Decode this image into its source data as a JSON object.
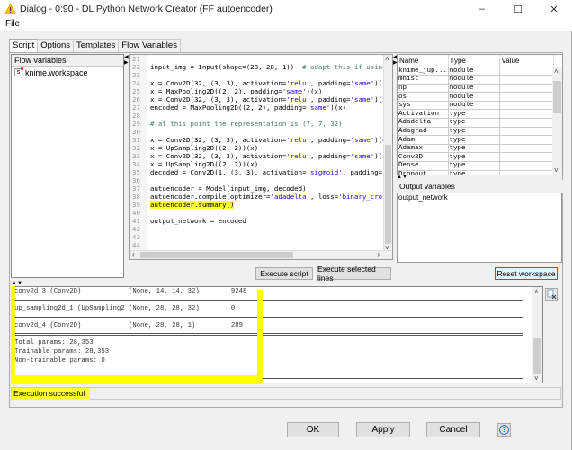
{
  "window": {
    "title": "Dialog - 0:90 - DL Python Network Creator (FF autoencoder)",
    "controls": {
      "minimize": "–",
      "maximize": "☐",
      "close": "✕"
    }
  },
  "menu": {
    "file": "File"
  },
  "tabs": [
    {
      "label": "Script",
      "active": true
    },
    {
      "label": "Options",
      "active": false
    },
    {
      "label": "Templates",
      "active": false
    },
    {
      "label": "Flow Variables",
      "active": false
    }
  ],
  "flow_variables": {
    "header": "Flow variables",
    "items": [
      {
        "icon": "s",
        "label": "knime.workspace"
      }
    ]
  },
  "editor": {
    "lines": [
      {
        "n": "21",
        "parts": []
      },
      {
        "n": "22",
        "parts": [
          {
            "t": "input_img = Input(shape=(28, 28, 1))  "
          },
          {
            "t": "# adapt this if using `c",
            "c": "cmt"
          }
        ]
      },
      {
        "n": "23",
        "parts": []
      },
      {
        "n": "24",
        "parts": [
          {
            "t": "x = Conv2D(32, (3, 3), activation="
          },
          {
            "t": "'relu'",
            "c": "str"
          },
          {
            "t": ", padding="
          },
          {
            "t": "'same'",
            "c": "str"
          },
          {
            "t": ")(inpu"
          }
        ]
      },
      {
        "n": "25",
        "parts": [
          {
            "t": "x = MaxPooling2D((2, 2), padding="
          },
          {
            "t": "'same'",
            "c": "str"
          },
          {
            "t": ")(x)"
          }
        ]
      },
      {
        "n": "26",
        "parts": [
          {
            "t": "x = Conv2D(32, (3, 3), activation="
          },
          {
            "t": "'relu'",
            "c": "str"
          },
          {
            "t": ", padding="
          },
          {
            "t": "'same'",
            "c": "str"
          },
          {
            "t": ")(x)"
          }
        ]
      },
      {
        "n": "27",
        "parts": [
          {
            "t": "encoded = MaxPooling2D((2, 2), padding="
          },
          {
            "t": "'same'",
            "c": "str"
          },
          {
            "t": ")(x)"
          }
        ]
      },
      {
        "n": "28",
        "parts": []
      },
      {
        "n": "29",
        "parts": [
          {
            "t": "# at this point the representation is (7, 7, 32)",
            "c": "cmt"
          }
        ]
      },
      {
        "n": "30",
        "parts": []
      },
      {
        "n": "31",
        "parts": [
          {
            "t": "x = Conv2D(32, (3, 3), activation="
          },
          {
            "t": "'relu'",
            "c": "str"
          },
          {
            "t": ", padding="
          },
          {
            "t": "'same'",
            "c": "str"
          },
          {
            "t": ")(enco"
          }
        ]
      },
      {
        "n": "32",
        "parts": [
          {
            "t": "x = UpSampling2D((2, 2))(x)"
          }
        ]
      },
      {
        "n": "33",
        "parts": [
          {
            "t": "x = Conv2D(32, (3, 3), activation="
          },
          {
            "t": "'relu'",
            "c": "str"
          },
          {
            "t": ", padding="
          },
          {
            "t": "'same'",
            "c": "str"
          },
          {
            "t": ")(x)"
          }
        ]
      },
      {
        "n": "34",
        "parts": [
          {
            "t": "x = UpSampling2D((2, 2))(x)"
          }
        ]
      },
      {
        "n": "35",
        "parts": [
          {
            "t": "decoded = Conv2D(1, (3, 3), activation="
          },
          {
            "t": "'sigmoid'",
            "c": "str"
          },
          {
            "t": ", padding="
          },
          {
            "t": "'sam",
            "c": "str"
          }
        ]
      },
      {
        "n": "36",
        "parts": []
      },
      {
        "n": "37",
        "parts": [
          {
            "t": "autoencoder = Model(input_img, decoded)"
          }
        ]
      },
      {
        "n": "38",
        "parts": [
          {
            "t": "autoencoder.compile(optimizer="
          },
          {
            "t": "'adadelta'",
            "c": "str"
          },
          {
            "t": ", loss="
          },
          {
            "t": "'binary_crossen",
            "c": "str"
          }
        ]
      },
      {
        "n": "39",
        "parts": [
          {
            "t": "autoencoder.summary()",
            "c": "hl"
          }
        ]
      },
      {
        "n": "40",
        "parts": []
      },
      {
        "n": "41",
        "parts": [
          {
            "t": "output_network = encoded"
          }
        ]
      },
      {
        "n": "42",
        "parts": []
      },
      {
        "n": "43",
        "parts": []
      },
      {
        "n": "44",
        "parts": []
      }
    ],
    "execute_script": "Execute script",
    "execute_selected": "Execute selected lines"
  },
  "variables": {
    "columns": [
      "Name",
      "Type",
      "Value"
    ],
    "rows": [
      [
        "knime_jup...",
        "module",
        ""
      ],
      [
        "mnist",
        "module",
        ""
      ],
      [
        "np",
        "module",
        ""
      ],
      [
        "os",
        "module",
        ""
      ],
      [
        "sys",
        "module",
        ""
      ],
      [
        "Activation",
        "type",
        ""
      ],
      [
        "Adadelta",
        "type",
        ""
      ],
      [
        "Adagrad",
        "type",
        ""
      ],
      [
        "Adam",
        "type",
        ""
      ],
      [
        "Adamax",
        "type",
        ""
      ],
      [
        "Conv2D",
        "type",
        ""
      ],
      [
        "Dense",
        "type",
        ""
      ],
      [
        "Dropout",
        "type",
        ""
      ]
    ]
  },
  "output_variables": {
    "header": "Output variables",
    "items": [
      "output_network"
    ],
    "reset": "Reset workspace"
  },
  "console": {
    "rows": [
      {
        "kind": "text",
        "t": "conv2d_3 (Conv2D)            (None, 14, 14, 32)        9248"
      },
      {
        "kind": "sep"
      },
      {
        "kind": "text",
        "t": "up_sampling2d_1 (UpSampling2 (None, 28, 28, 32)        0"
      },
      {
        "kind": "sep"
      },
      {
        "kind": "text",
        "t": "conv2d_4 (Conv2D)            (None, 28, 28, 1)         289"
      },
      {
        "kind": "dbl"
      },
      {
        "kind": "text",
        "t": "Total params: 28,353"
      },
      {
        "kind": "text",
        "t": "Trainable params: 28,353"
      },
      {
        "kind": "text",
        "t": "Non-trainable params: 0"
      },
      {
        "kind": "blank"
      },
      {
        "kind": "sep"
      }
    ]
  },
  "status": {
    "text": "Execution successful"
  },
  "footer": {
    "ok": "OK",
    "apply": "Apply",
    "cancel": "Cancel",
    "help": "?"
  },
  "colors": {
    "highlight": "#ffff00",
    "string": "#2a00ff",
    "comment": "#3f7f5f",
    "focus": "#0078d7"
  }
}
